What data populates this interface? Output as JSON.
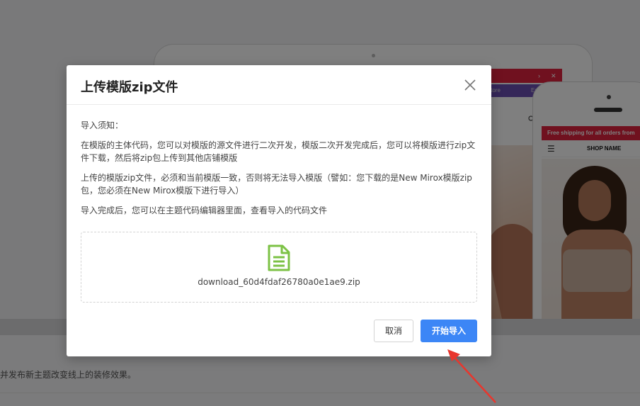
{
  "background": {
    "tablet": {
      "banner_chevron": "›",
      "banner_close": "✕",
      "nav_item_1": "...otore",
      "nav_item_2": "Englis...",
      "search_icon": "search-icon"
    },
    "phone": {
      "banner_text": "Free shipping for all orders from",
      "menu_icon": "☰",
      "shop_name": "SHOP NAME"
    },
    "bottom_text": "并发布新主题改变线上的装修效果。"
  },
  "modal": {
    "title": "上传模版zip文件",
    "notice_heading": "导入须知：",
    "paragraphs": [
      "在模版的主体代码，您可以对模版的源文件进行二次开发，模版二次开发完成后，您可以将模版进行zip文件下载，然后将zip包上传到其他店铺模版",
      "上传的模版zip文件，必须和当前模版一致，否则将无法导入模版（譬如：您下载的是New Mirox模版zip包，您必须在New Mirox模版下进行导入）",
      "导入完成后，您可以在主题代码编辑器里面，查看导入的代码文件"
    ],
    "file_name": "download_60d4fdaf26780a0e1ae9.zip",
    "cancel_label": "取消",
    "start_label": "开始导入"
  },
  "colors": {
    "primary": "#3c86f6",
    "file_icon": "#7cc245",
    "arrow": "#e8362d",
    "promo_red": "#e0233f"
  }
}
